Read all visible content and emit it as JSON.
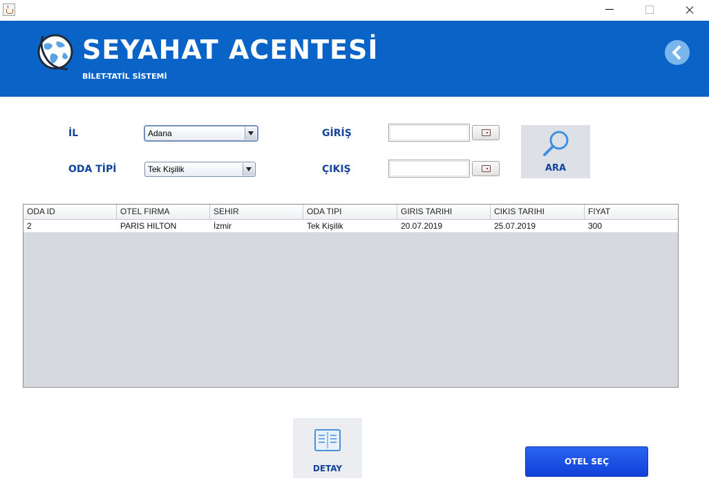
{
  "window": {
    "minimize_icon": "minimize-icon",
    "maximize_icon": "maximize-icon",
    "close_icon": "close-icon"
  },
  "header": {
    "title": "SEYAHAT ACENTESİ",
    "subtitle": "BİLET-TATİL SİSTEMİ",
    "logo_icon": "globe-icon",
    "back_icon": "chevron-left-icon",
    "background": "#0a64c8"
  },
  "filters": {
    "city_label": "İL",
    "city_value": "Adana",
    "room_type_label": "ODA TİPİ",
    "room_type_value": "Tek Kişilik",
    "checkin_label": "GİRİŞ",
    "checkin_value": "",
    "checkout_label": "ÇIKIŞ",
    "checkout_value": "",
    "calendar_icon": "calendar-icon"
  },
  "search": {
    "label": "ARA",
    "icon": "search-icon"
  },
  "table": {
    "columns": [
      "ODA ID",
      "OTEL FIRMA",
      "SEHIR",
      "ODA TIPI",
      "GIRIS TARIHI",
      "CIKIS TARIHI",
      "FIYAT"
    ],
    "rows": [
      [
        "2",
        "PARIS HILTON",
        "İzmir",
        "Tek Kişilik",
        "20.07.2019",
        "25.07.2019",
        "300"
      ]
    ]
  },
  "actions": {
    "detail_label": "DETAY",
    "detail_icon": "details-list-icon",
    "select_hotel_label": "OTEL SEÇ"
  },
  "colors": {
    "label_blue": "#13439a",
    "primary_button": "#1a50e6"
  }
}
